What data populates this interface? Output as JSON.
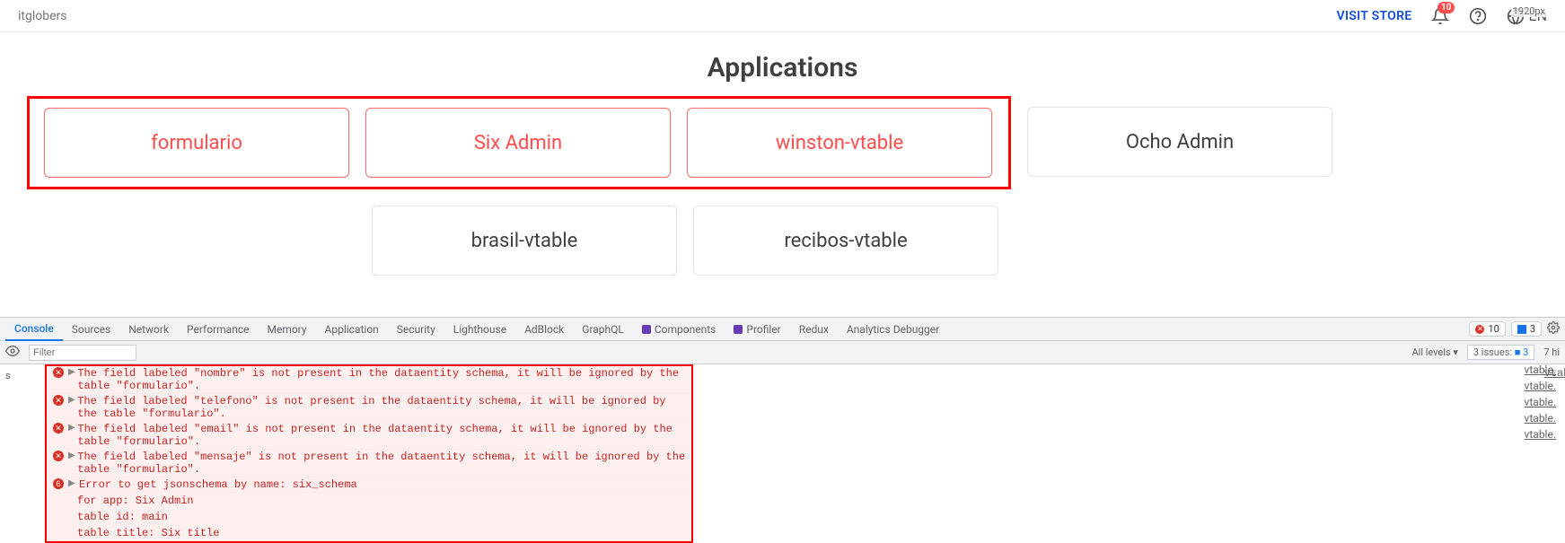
{
  "topbar": {
    "workspace": "itglobers",
    "visit_store": "VISIT STORE",
    "notification_count": "10",
    "language": "EN",
    "resolution_label": "1920px"
  },
  "page": {
    "title": "Applications"
  },
  "apps": {
    "highlighted": [
      {
        "label": "formulario"
      },
      {
        "label": "Six Admin"
      },
      {
        "label": "winston-vtable"
      }
    ],
    "outside_first_row": [
      {
        "label": "Ocho Admin"
      }
    ],
    "second_row": [
      {
        "label": "brasil-vtable"
      },
      {
        "label": "recibos-vtable"
      }
    ]
  },
  "devtools": {
    "tabs": [
      "Console",
      "Sources",
      "Network",
      "Performance",
      "Memory",
      "Application",
      "Security",
      "Lighthouse",
      "AdBlock",
      "GraphQL"
    ],
    "ext_tabs": [
      "Components",
      "Profiler"
    ],
    "more_tabs": [
      "Redux",
      "Analytics Debugger"
    ],
    "error_count": "10",
    "message_count": "3",
    "filter_placeholder": "Filter",
    "levels_label": "All levels ▾",
    "issues_label": "3 issues:",
    "issues_blue": "3",
    "hidden_label": "7 hi",
    "gutter": "s",
    "logs": [
      {
        "type": "warn",
        "text": "The field labeled \"nombre\" is not present in the dataentity schema, it will be ignored by the table \"formulario\".",
        "src": "vtable."
      },
      {
        "type": "warn",
        "text": "The field labeled \"telefono\" is not present in the dataentity schema, it will be ignored by the table \"formulario\".",
        "src": "vtable."
      },
      {
        "type": "warn",
        "text": "The field labeled \"email\" is not present in the dataentity schema, it will be ignored by the table \"formulario\".",
        "src": "vtable."
      },
      {
        "type": "warn",
        "text": "The field labeled \"mensaje\" is not present in the dataentity schema, it will be ignored by the table \"formulario\".",
        "src": "vtable."
      }
    ],
    "error_log": {
      "count_badge": "6",
      "lines": [
        "Error to get jsonschema by name: six_schema",
        "for app: Six Admin",
        "table id: main",
        "table title: Six title"
      ],
      "src": "vtable."
    }
  }
}
